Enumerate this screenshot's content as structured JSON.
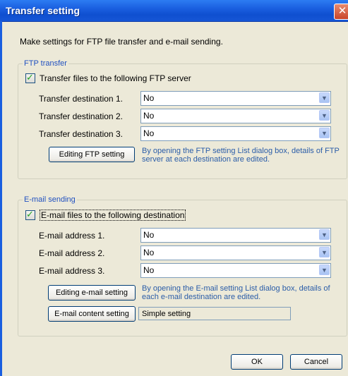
{
  "window": {
    "title": "Transfer setting",
    "close_glyph": "✕"
  },
  "description": "Make settings for FTP file transfer and e-mail sending.",
  "ftp": {
    "legend": "FTP transfer",
    "checkbox_label": "Transfer files to the following FTP server",
    "checked": true,
    "rows": [
      {
        "label": "Transfer destination 1.",
        "value": "No"
      },
      {
        "label": "Transfer destination 2.",
        "value": "No"
      },
      {
        "label": "Transfer destination 3.",
        "value": "No"
      }
    ],
    "edit_button": "Editing FTP setting",
    "note": "By opening the FTP setting List dialog box, details of FTP server at each destination are edited."
  },
  "mail": {
    "legend": "E-mail sending",
    "checkbox_label": "E-mail files to the following destination",
    "checked": true,
    "rows": [
      {
        "label": "E-mail address 1.",
        "value": "No"
      },
      {
        "label": "E-mail address 2.",
        "value": "No"
      },
      {
        "label": "E-mail address 3.",
        "value": "No"
      }
    ],
    "edit_button": "Editing e-mail setting",
    "note": "By opening the E-mail setting List dialog box, details of each e-mail destination are edited.",
    "content_button": "E-mail content setting",
    "content_value": "Simple setting"
  },
  "footer": {
    "ok": "OK",
    "cancel": "Cancel"
  },
  "colors": {
    "title_bar": "#1a5fe0",
    "note_text": "#2b5da8",
    "legend_text": "#2151c0"
  }
}
